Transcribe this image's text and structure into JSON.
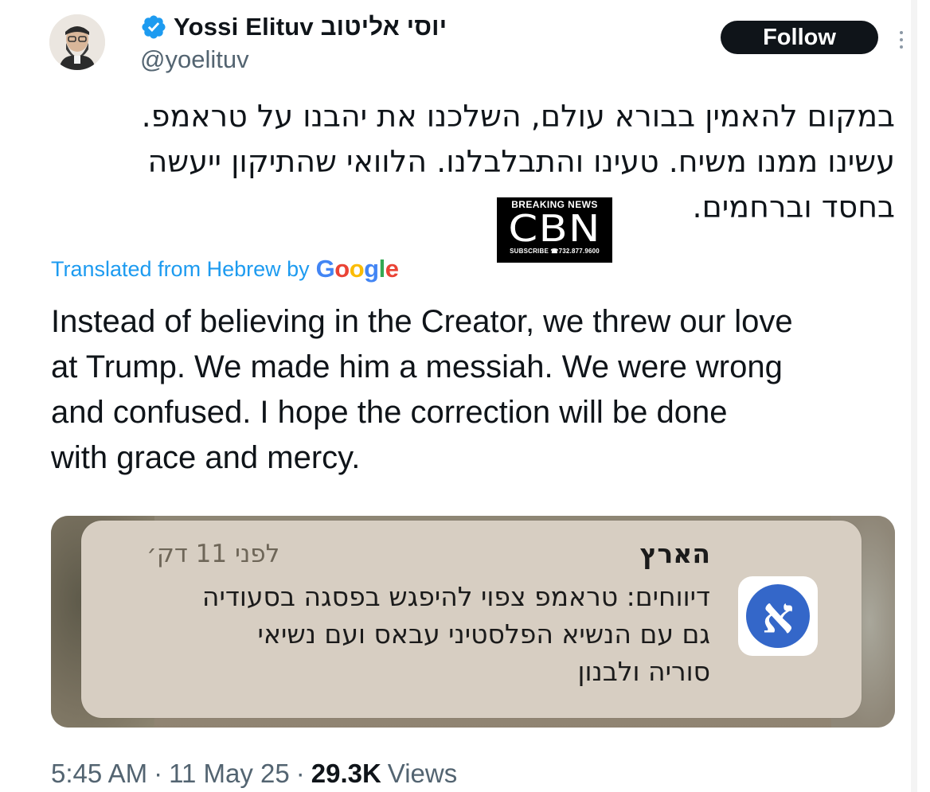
{
  "author": {
    "display_name": "Yossi Elituv יוסי אליטוב",
    "handle": "@yoelituv",
    "verified": true
  },
  "follow_label": "Follow",
  "post": {
    "hebrew_lines": [
      "במקום להאמין בבורא עולם, השלכנו את יהבנו על טראמפ.",
      "עשינו ממנו משיח. טעינו והתבלבלנו. הלוואי שהתיקון ייעשה",
      "בחסד וברחמים."
    ],
    "translation_label": "Translated from Hebrew by",
    "translation_provider": "Google",
    "english_lines": [
      "Instead of believing in the Creator, we threw our love",
      "at Trump. We made him a messiah. We were wrong",
      "and confused. I hope the correction will be done",
      "with grace and mercy."
    ]
  },
  "overlay_logo": {
    "top": "BREAKING NEWS",
    "main": "CBN",
    "bottom": "SUBSCRIBE ☎732.877.9600"
  },
  "media": {
    "notification": {
      "source": "הארץ",
      "time": "לפני 11 דק׳",
      "app_icon_letter": "א",
      "body_lines": [
        "דיווחים: טראמפ צפוי להיפגש בפסגה בסעודיה",
        "גם עם הנשיא הפלסטיני עבאס ועם נשיאי",
        "סוריה ולבנון"
      ]
    }
  },
  "meta": {
    "time": "5:45 AM",
    "date": "11 May 25",
    "separator": "·",
    "views_count": "29.3K",
    "views_label": "Views"
  },
  "colors": {
    "accent": "#1d9bf0",
    "text": "#0f1419",
    "muted": "#536471",
    "follow_bg": "#0f1419",
    "haaretz_blue": "#3467c9"
  },
  "icons": {
    "verified": "verified-badge-icon",
    "more": "more-options-icon"
  }
}
